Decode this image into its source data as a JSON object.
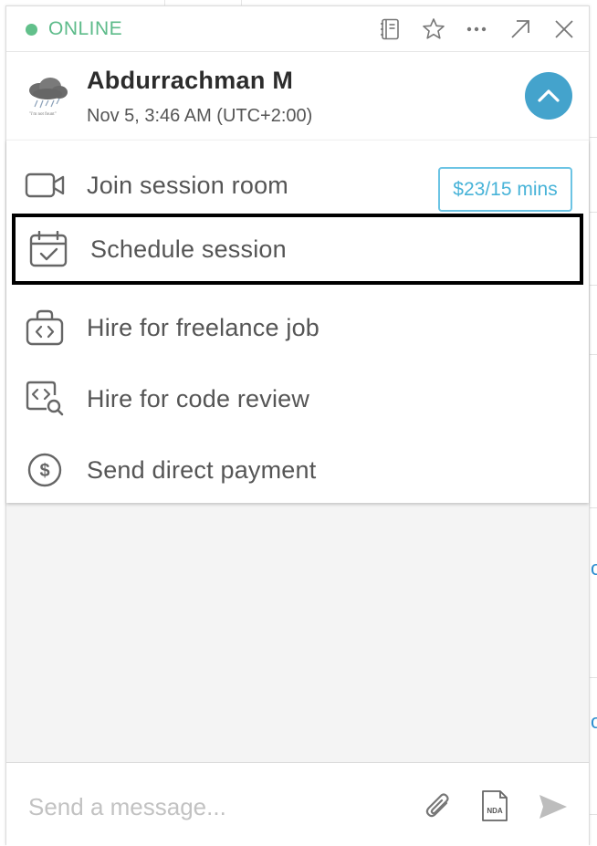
{
  "status": {
    "label": "ONLINE",
    "color": "#62c08b"
  },
  "window_actions": {
    "icons": [
      "notebook-icon",
      "star-icon",
      "more-icon",
      "pop-out-icon",
      "close-icon"
    ]
  },
  "user": {
    "name": "Abdurrachman M",
    "local_time": "Nov 5, 3:46 AM (UTC+2:00)",
    "avatar_caption": "\"i'm not fount\""
  },
  "menu": {
    "items": [
      {
        "label": "Join session room",
        "icon": "video-camera-icon",
        "badge": "$23/15 mins"
      },
      {
        "label": "Schedule session",
        "icon": "calendar-check-icon"
      },
      {
        "label": "Hire for freelance job",
        "icon": "briefcase-code-icon"
      },
      {
        "label": "Hire for code review",
        "icon": "code-search-icon"
      },
      {
        "label": "Send direct payment",
        "icon": "dollar-circle-icon"
      }
    ]
  },
  "composer": {
    "placeholder": "Send a message...",
    "nda_label": "NDA"
  },
  "colors": {
    "accent": "#44a3cc",
    "badge": "#47b3d8",
    "online": "#62c08b"
  }
}
